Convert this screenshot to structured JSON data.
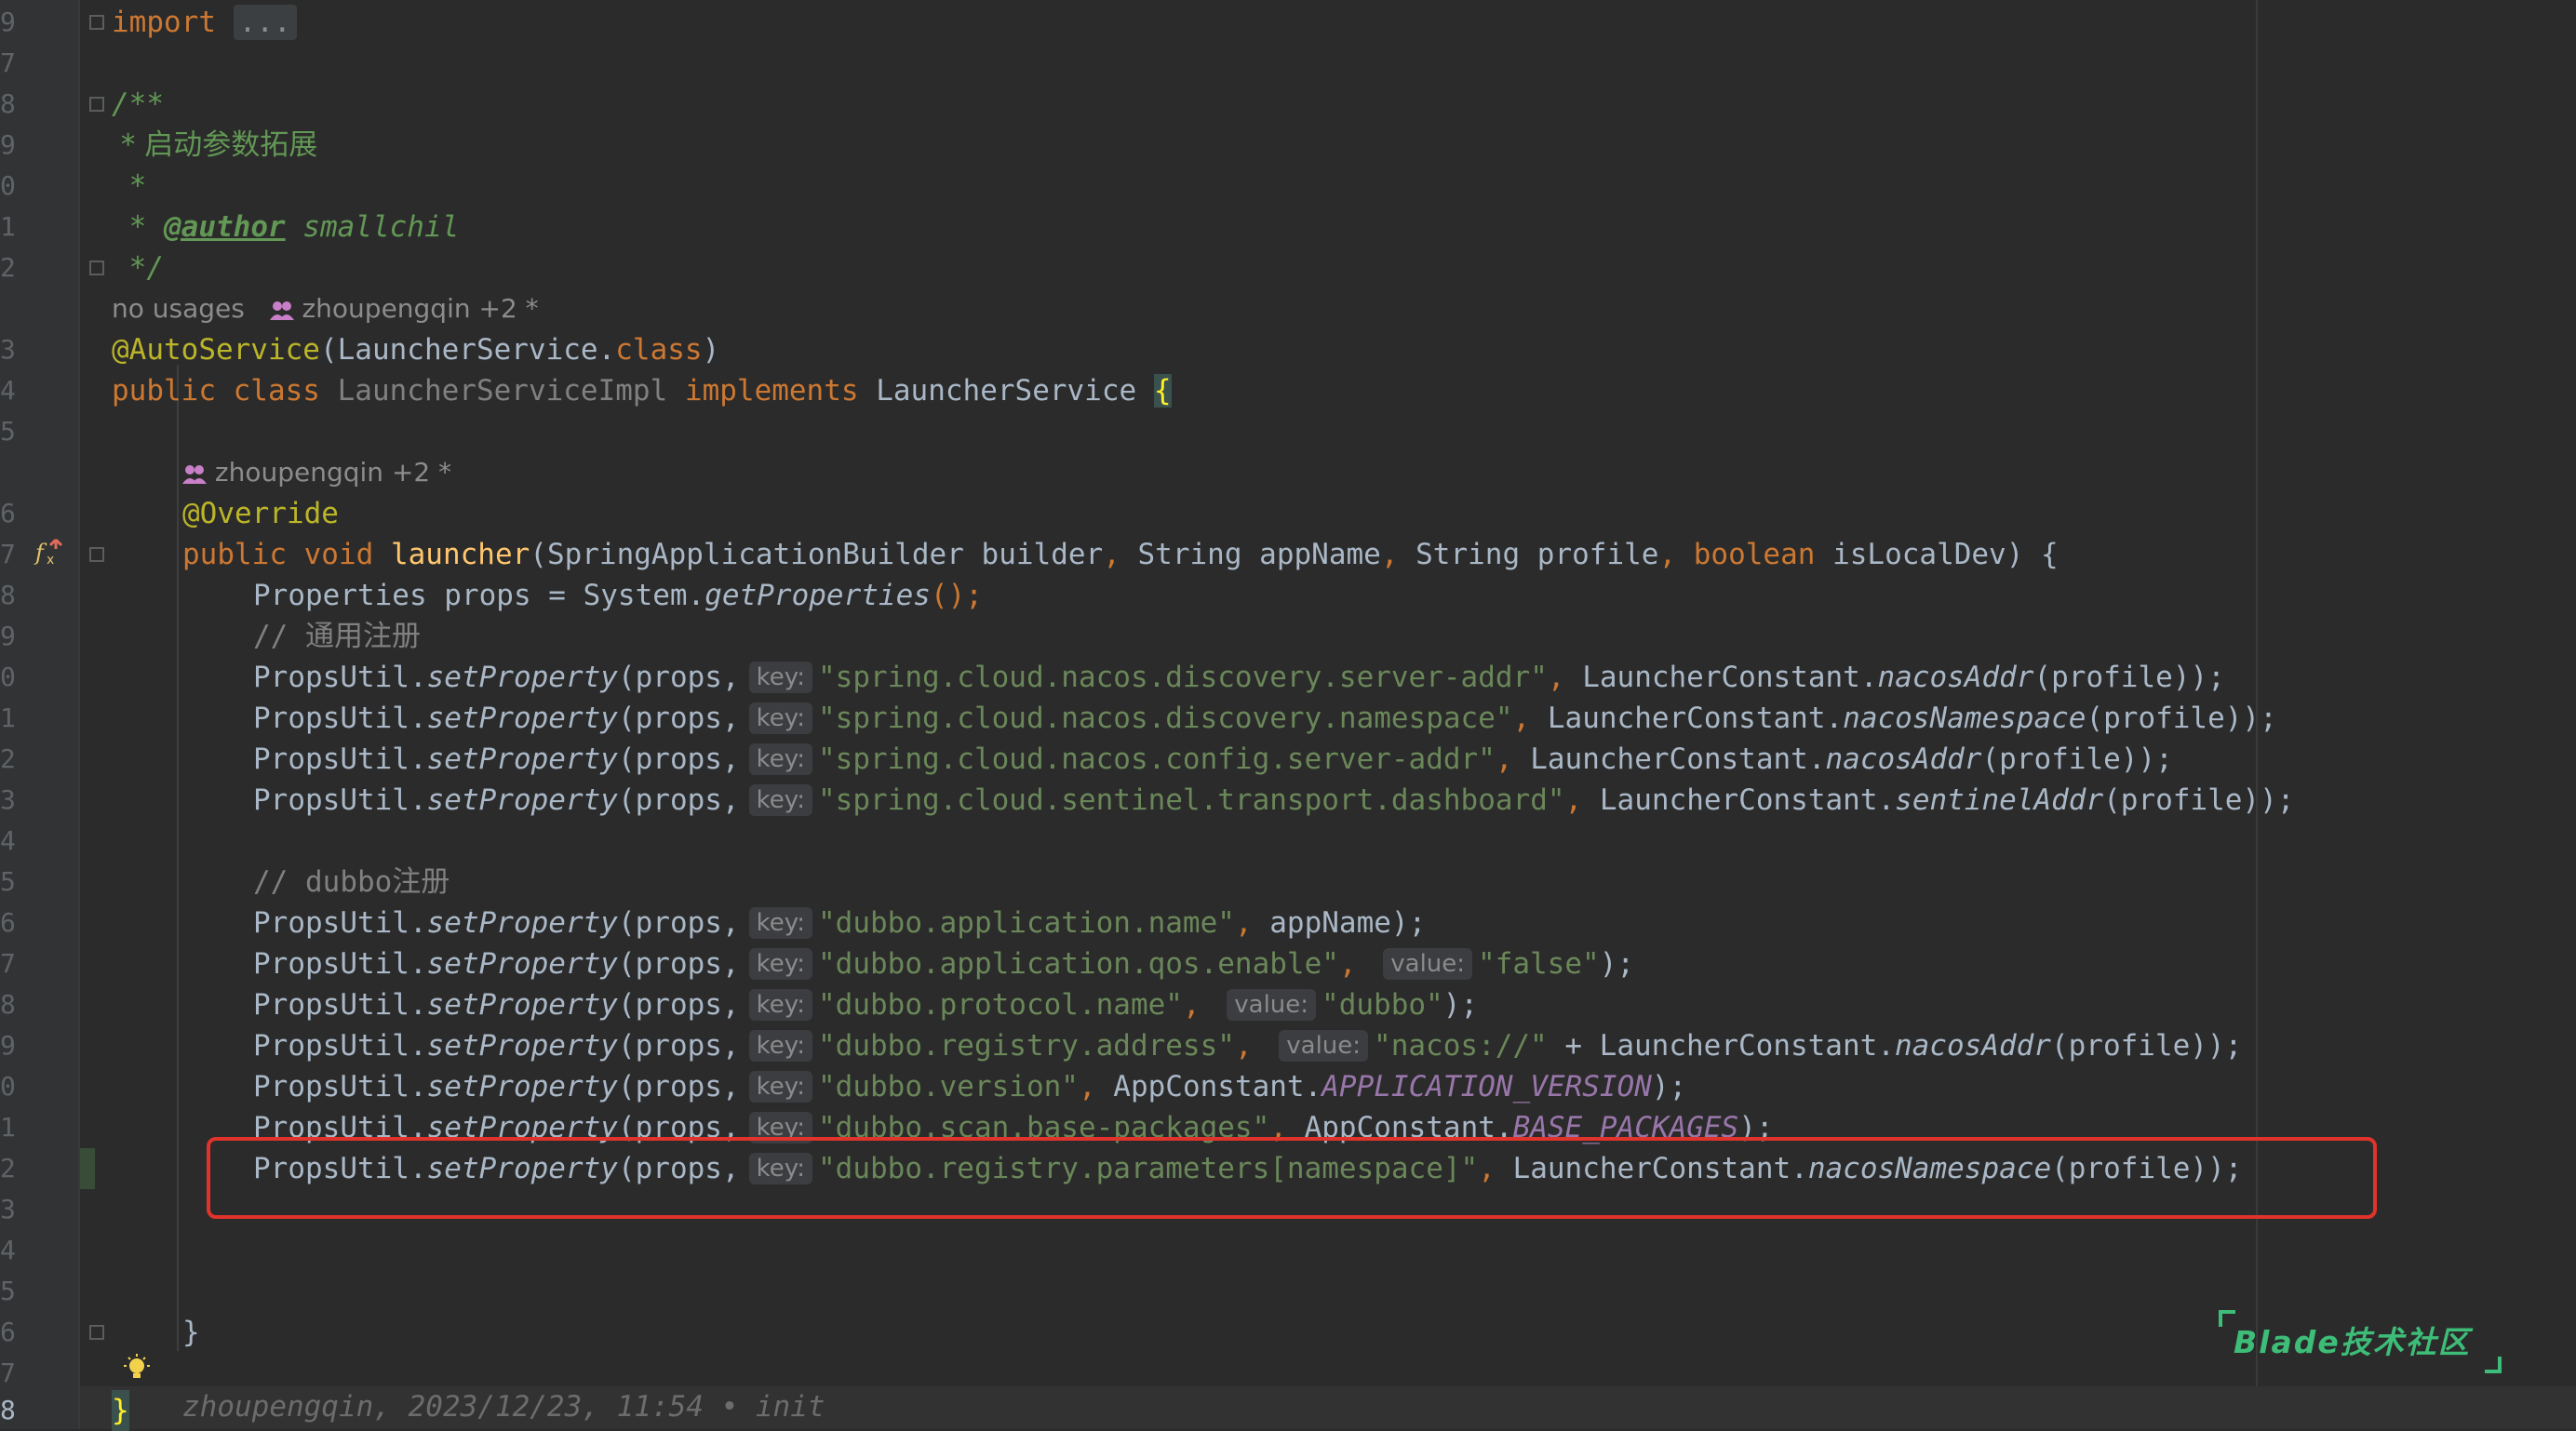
{
  "editor": {
    "line_numbers": [
      "9",
      "7",
      "8",
      "9",
      "0",
      "1",
      "2",
      "3",
      "4",
      "5",
      "6",
      "7",
      "8",
      "9",
      "0",
      "1",
      "2",
      "3",
      "4",
      "5",
      "6",
      "7",
      "8",
      "9",
      "0",
      "1",
      "2",
      "3",
      "4",
      "5",
      "6",
      "7",
      "8"
    ],
    "import_kw": "import",
    "import_collapsed": "...",
    "doc_open": "/**",
    "doc_line1": " * 启动参数拓展",
    "doc_line2": " *",
    "doc_star": " * ",
    "doc_author_tag": "@author",
    "doc_author": " smallchil",
    "doc_close": " */",
    "class_usage": "no usages",
    "class_authors": "zhoupengqin +2 *",
    "annotation_autoservice": "@AutoService",
    "autoservice_args": "(LauncherService.",
    "autoservice_class_kw": "class",
    "autoservice_close": ")",
    "class_public": "public class ",
    "class_name": "LauncherServiceImpl",
    "class_implements": " implements ",
    "class_interface": "LauncherService ",
    "class_open_brace": "{",
    "method_authors": "zhoupengqin +2 *",
    "override": "@Override",
    "method_sig_kw": "public void ",
    "method_name": "launcher",
    "method_params_1": "(SpringApplicationBuilder builder",
    "comma": ", ",
    "method_params_2": "String appName",
    "method_params_3": "String profile",
    "method_bool_kw": "boolean",
    "method_params_4": " isLocalDev) {",
    "props_line": "Properties props = System.",
    "props_method": "getProperties",
    "props_end": "();",
    "comment_common": "// 通用注册",
    "comment_dubbo": "// dubbo注册",
    "call_prefix": "PropsUtil.",
    "call_method": "setProperty",
    "call_args": "(props,",
    "key_hint": "key:",
    "value_hint": "value:",
    "rows": [
      {
        "key": "\"spring.cloud.nacos.discovery.server-addr\"",
        "rest_cls": "LauncherConstant.",
        "rest_fn": "nacosAddr",
        "rest_end": "(profile));"
      },
      {
        "key": "\"spring.cloud.nacos.discovery.namespace\"",
        "rest_cls": "LauncherConstant.",
        "rest_fn": "nacosNamespace",
        "rest_end": "(profile));"
      },
      {
        "key": "\"spring.cloud.nacos.config.server-addr\"",
        "rest_cls": "LauncherConstant.",
        "rest_fn": "nacosAddr",
        "rest_end": "(profile));"
      },
      {
        "key": "\"spring.cloud.sentinel.transport.dashboard\"",
        "rest_cls": "LauncherConstant.",
        "rest_fn": "sentinelAddr",
        "rest_end": "(profile));"
      }
    ],
    "dubbo_rows": {
      "r1_key": "\"dubbo.application.name\"",
      "r1_rest": "appName);",
      "r2_key": "\"dubbo.application.qos.enable\"",
      "r2_val": "\"false\"",
      "r2_end": ");",
      "r3_key": "\"dubbo.protocol.name\"",
      "r3_val": "\"dubbo\"",
      "r3_end": ");",
      "r4_key": "\"dubbo.registry.address\"",
      "r4_val": "\"nacos://\"",
      "r4_plus": " + LauncherConstant.",
      "r4_fn": "nacosAddr",
      "r4_end": "(profile));",
      "r5_key": "\"dubbo.version\"",
      "r5_cls": "AppConstant.",
      "r5_const": "APPLICATION_VERSION",
      "r5_end": ");",
      "r6_key": "\"dubbo.scan.base-packages\"",
      "r6_cls": "AppConstant.",
      "r6_const": "BASE_PACKAGES",
      "r6_end": ");",
      "r7_key": "\"dubbo.registry.parameters[namespace]\"",
      "r7_cls": "LauncherConstant.",
      "r7_fn": "nacosNamespace",
      "r7_end": "(profile));"
    },
    "method_close": "}",
    "class_close": "}",
    "blame": "zhoupengqin, 2023/12/23, 11:54 • init"
  },
  "watermark": {
    "text": "Blade技术社区",
    "color": "#3dbd78"
  },
  "colors": {
    "highlight_box": "#e0332b",
    "background": "#2b2b2b"
  }
}
